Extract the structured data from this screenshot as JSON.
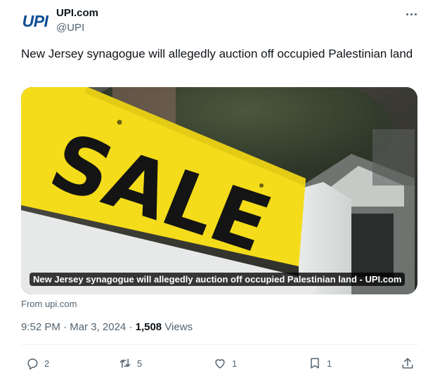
{
  "author": {
    "avatar_text": "UPI",
    "display_name": "UPI.com",
    "handle": "@UPI"
  },
  "tweet": {
    "text": "New Jersey synagogue will allegedly auction off occupied Palestinian land"
  },
  "card": {
    "image_sign_text": "SALE",
    "caption": "New Jersey synagogue will allegedly auction off occupied Palestinian land - UPI.com",
    "source": "From upi.com"
  },
  "meta": {
    "time": "9:52 PM",
    "separator": "·",
    "date": "Mar 3, 2024",
    "views_count": "1,508",
    "views_label": "Views"
  },
  "actions": {
    "reply_count": "2",
    "retweet_count": "5",
    "like_count": "1",
    "bookmark_count": "1"
  },
  "icons": [
    "more-options-icon",
    "reply-icon",
    "retweet-icon",
    "like-icon",
    "bookmark-icon",
    "share-icon"
  ],
  "colors": {
    "text_primary": "#0f1419",
    "text_secondary": "#536471",
    "divider": "#eff3f4",
    "brand": "#0b4f94",
    "sign_yellow": "#f4dc1a"
  }
}
